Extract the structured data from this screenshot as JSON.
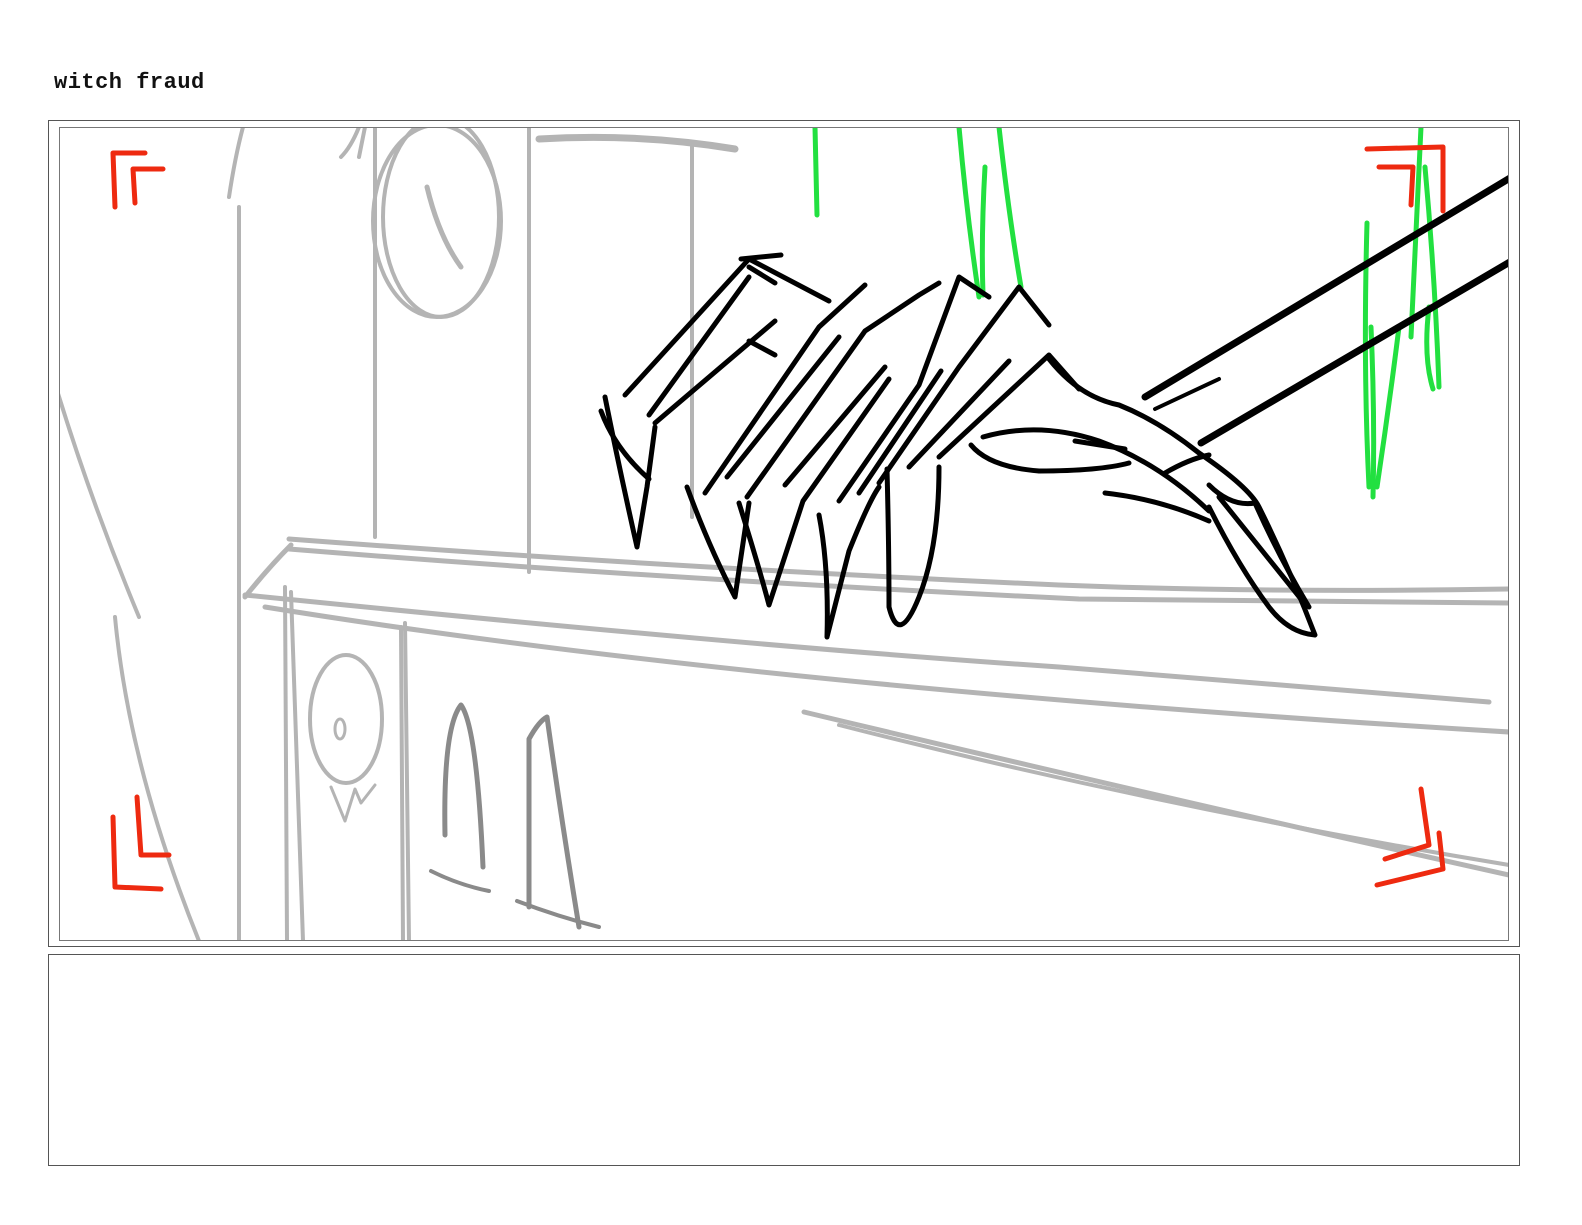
{
  "page": {
    "title": "witch fraud"
  },
  "panel": {
    "sketch_colors": {
      "background_lines": "#b4b4b4",
      "foreground_hand": "#000000",
      "effects": "#22e040",
      "frame_guides": "#ee2a10"
    },
    "subjects": [
      "clawed-hand-icon",
      "cuckoo-clock-icon",
      "wooden-counter-icon",
      "green-drip-effect-icon",
      "crop-corner-marks-icon"
    ]
  },
  "notes": {
    "text": ""
  }
}
